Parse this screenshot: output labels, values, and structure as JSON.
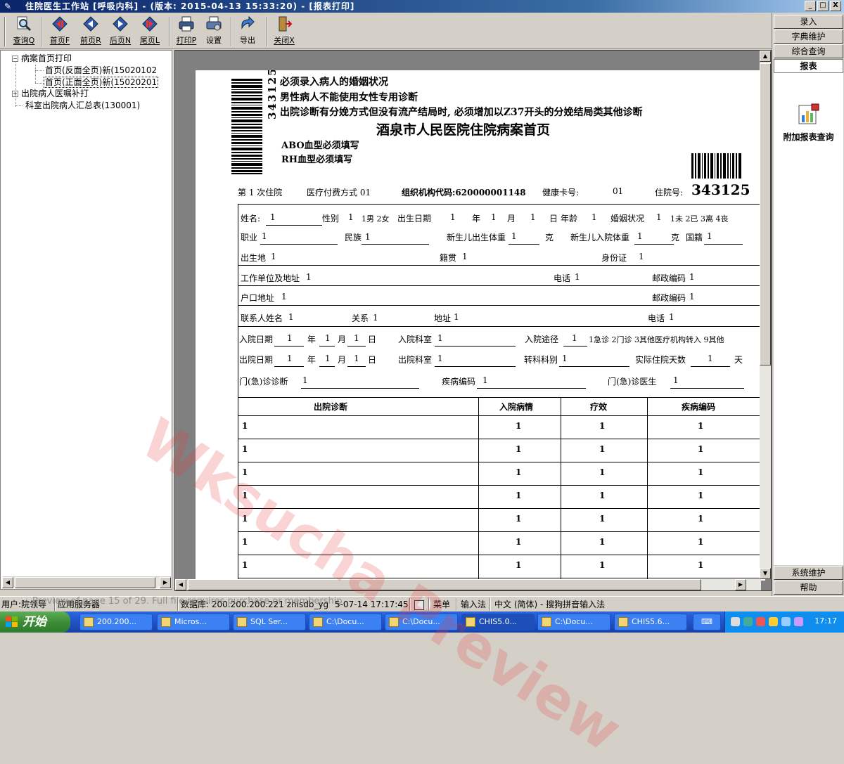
{
  "window": {
    "title": "住院医生工作站 [呼吸内科] - (版本: 2015-04-13 15:33:20) - [报表打印]",
    "minimize": "_",
    "restore": "□",
    "close": "X"
  },
  "toolbar": {
    "query": "查询Q",
    "first": "首页F",
    "prev": "前页R",
    "next": "后页N",
    "last": "尾页L",
    "print": "打印P",
    "settings": "设置",
    "export": "导出",
    "close": "关闭X"
  },
  "tree": {
    "root1": "病案首页打印",
    "child1": "首页(反面全页)新(15020102",
    "child2": "首页(正面全页)新(15020201",
    "root2": "出院病人医嘱补打",
    "root3": "科室出院病人汇总表(130001)"
  },
  "side": {
    "btn_entry": "录入",
    "btn_dict": "字典维护",
    "btn_query": "综合查询",
    "btn_report": "报表",
    "addon_report": "附加报表查询",
    "btn_sysmaint": "系统维护",
    "btn_help": "帮助"
  },
  "form": {
    "notice1": "必须录入病人的婚姻状况",
    "notice2": "男性病人不能使用女性专用诊断",
    "notice3": "出院诊断有分娩方式但没有流产结局时, 必须增加以Z37开头的分娩结局类其他诊断",
    "title": "酒泉市人民医院住院病案首页",
    "abo": "ABO血型必须填写",
    "rh": "RH血型必须填写",
    "barcode_vertical": "343125",
    "row_visit": "第 1 次住院",
    "row_paytype": "医疗付费方式  01",
    "row_org": "组织机构代码:620000001148",
    "row_card": "健康卡号:",
    "row_card_val": "01",
    "row_inpatient_label": "住院号:",
    "row_inpatient_no": "343125",
    "l1_name": "姓名:",
    "l1_name_v": "1",
    "l1_sex": "性别",
    "l1_sex_v": "1",
    "l1_sex_opts": "1男 2女",
    "l1_birth": "出生日期",
    "l1_birth_y": "1",
    "l1_nian": "年",
    "l1_birth_m": "1",
    "l1_yue": "月",
    "l1_birth_d": "1",
    "l1_ri": "日",
    "l1_age": "年龄",
    "l1_age_v": "1",
    "l1_marital": "婚姻状况",
    "l1_marital_v": "1",
    "l1_marital_opts": "1未 2已 3离 4丧",
    "l2_job": "职业",
    "l2_job_v": "1",
    "l2_nation": "民族",
    "l2_nation_v": "1",
    "l2_bw": "新生儿出生体重",
    "l2_bw_v": "1",
    "l2_ke1": "克",
    "l2_aw": "新生儿入院体重",
    "l2_aw_v": "1",
    "l2_ke2": "克",
    "l2_country": "国籍",
    "l2_country_v": "1",
    "l3_birthplace": "出生地",
    "l3_birthplace_v": "1",
    "l3_native": "籍贯",
    "l3_native_v": "1",
    "l3_idcard": "身份证",
    "l3_idcard_v": "1",
    "l4_work": "工作单位及地址",
    "l4_work_v": "1",
    "l4_phone": "电话",
    "l4_phone_v": "1",
    "l4_zip": "邮政编码",
    "l4_zip_v": "1",
    "l5_hukou": "户口地址",
    "l5_hukou_v": "1",
    "l5_zip": "邮政编码",
    "l5_zip_v": "1",
    "l6_contact": "联系人姓名",
    "l6_contact_v": "1",
    "l6_relation": "关系",
    "l6_relation_v": "1",
    "l6_addr": "地址",
    "l6_addr_v": "1",
    "l6_phone": "电话",
    "l6_phone_v": "1",
    "l7_admit": "入院日期",
    "l7_y": "1",
    "l7_nian": "年",
    "l7_m": "1",
    "l7_yue": "月",
    "l7_d": "1",
    "l7_ri": "日",
    "l7_dept": "入院科室",
    "l7_dept_v": "1",
    "l7_route": "入院途径",
    "l7_route_v": "1",
    "l7_route_opts": "1急诊 2门诊 3其他医疗机构转入 9其他",
    "l8_discharge": "出院日期",
    "l8_y": "1",
    "l8_nian": "年",
    "l8_m": "1",
    "l8_yue": "月",
    "l8_d": "1",
    "l8_ri": "日",
    "l8_dept": "出院科室",
    "l8_dept_v": "1",
    "l8_transfer": "转科科别",
    "l8_transfer_v": "1",
    "l8_days": "实际住院天数",
    "l8_days_v": "1",
    "l8_tian": "天",
    "l9_op_diag": "门(急)诊诊断",
    "l9_op_diag_v": "1",
    "l9_code": "疾病编码",
    "l9_code_v": "1",
    "l9_doctor": "门(急)诊医生",
    "l9_doctor_v": "1"
  },
  "diag_table": {
    "headers": [
      "出院诊断",
      "入院病情",
      "疗效",
      "疾病编码"
    ],
    "rows": [
      [
        "1",
        "1",
        "1",
        "1"
      ],
      [
        "1",
        "1",
        "1",
        "1"
      ],
      [
        "1",
        "1",
        "1",
        "1"
      ],
      [
        "1",
        "1",
        "1",
        "1"
      ],
      [
        "1",
        "1",
        "1",
        "1"
      ],
      [
        "1",
        "1",
        "1",
        "1"
      ],
      [
        "1",
        "1",
        "1",
        "1"
      ]
    ]
  },
  "status": {
    "user": "用户:院领导",
    "server": "应用服务器",
    "db": "数据库: 200.200.200.221  zhisdb_yg",
    "datetime": "5-07-14 17:17:45",
    "menu": "菜单",
    "ime": "输入法",
    "ime_name": "中文 (简体) - 搜狗拼音输入法"
  },
  "taskbar": {
    "start": "开始",
    "tasks": [
      "200.200...",
      "Micros...",
      "SQL Ser...",
      "C:\\Docu...",
      "C:\\Docu...",
      "CHIS5.0...",
      "C:\\Docu...",
      "CHIS5.6..."
    ],
    "clock": "17:17"
  },
  "overlay": {
    "watermark": "Wksucha Preview",
    "note": "Preview of page 15 of 29. Full file requires purchase or membership."
  }
}
